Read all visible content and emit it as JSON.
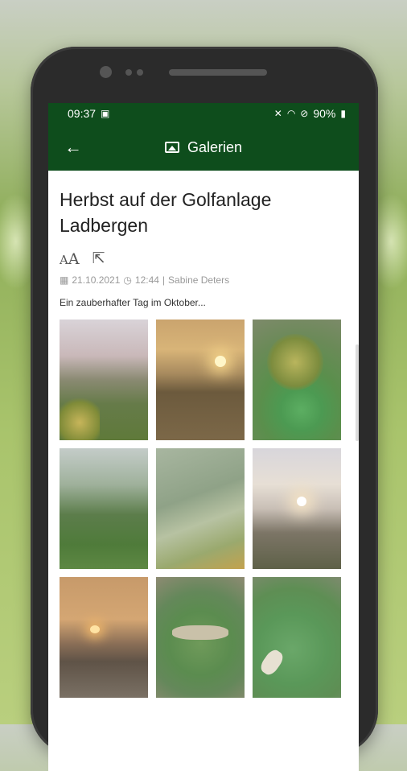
{
  "status_bar": {
    "time": "09:37",
    "battery": "90%"
  },
  "app_bar": {
    "title": "Galerien"
  },
  "article": {
    "title": "Herbst auf der Golfanlage Ladbergen",
    "date": "21.10.2021",
    "time": "12:44",
    "separator": "|",
    "author": "Sabine Deters",
    "teaser": "Ein zauberhafter Tag im Oktober...",
    "font_size_icon_small": "A",
    "font_size_icon_big": "A"
  },
  "icons": {
    "back": "arrow-left",
    "gallery": "image-frame",
    "share": "external-link",
    "calendar": "calendar",
    "clock": "clock"
  },
  "colors": {
    "app_bar": "#0e4d1c",
    "title_text": "#222222",
    "meta_text": "#999999"
  }
}
